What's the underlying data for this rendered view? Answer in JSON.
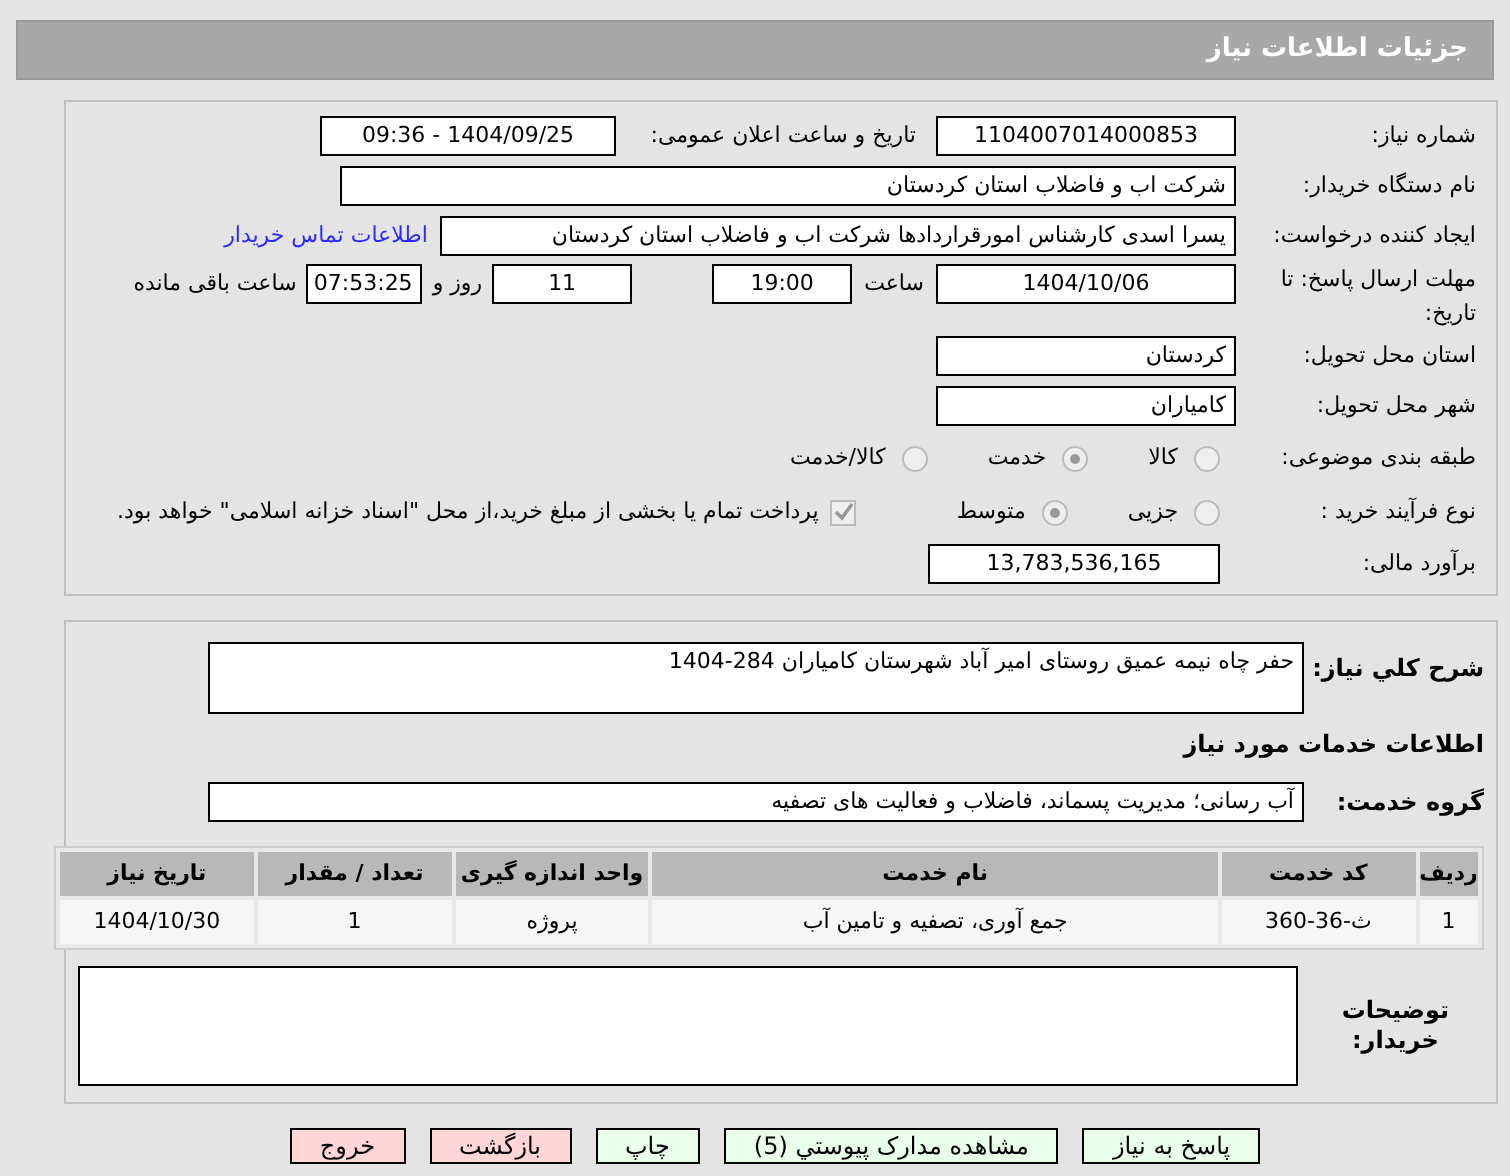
{
  "header": {
    "title": "جزئیات اطلاعات نیاز"
  },
  "need_number": {
    "label": "شماره نیاز:",
    "value": "1104007014000853"
  },
  "announce": {
    "label": "تاریخ و ساعت اعلان عمومی:",
    "value": "1404/09/25 - 09:36"
  },
  "buyer_org": {
    "label": "نام دستگاه خریدار:",
    "value": "شرکت اب و فاضلاب استان کردستان"
  },
  "requester": {
    "label": "ایجاد کننده درخواست:",
    "value": "یسرا اسدی کارشناس امورقراردادها شرکت اب و فاضلاب استان کردستان",
    "link": "اطلاعات تماس خریدار"
  },
  "deadline": {
    "label": "مهلت ارسال پاسخ: تا تاریخ:",
    "date": "1404/10/06",
    "time_label": "ساعت",
    "time": "19:00",
    "days": "11",
    "days_label": "روز و",
    "remaining": "07:53:25",
    "remaining_label": "ساعت باقی مانده"
  },
  "province": {
    "label": "استان محل تحویل:",
    "value": "کردستان"
  },
  "city": {
    "label": "شهر محل تحویل:",
    "value": "کامیاران"
  },
  "category": {
    "label": "طبقه بندی موضوعی:",
    "options": [
      {
        "label": "کالا",
        "selected": false
      },
      {
        "label": "خدمت",
        "selected": true
      },
      {
        "label": "کالا/خدمت",
        "selected": false
      }
    ]
  },
  "process": {
    "label": "نوع فرآیند خرید :",
    "options": [
      {
        "label": "جزیی",
        "selected": false
      },
      {
        "label": "متوسط",
        "selected": true
      }
    ],
    "payment": {
      "checked": true,
      "text": "پرداخت تمام یا بخشی از مبلغ خرید،از محل \"اسناد خزانه اسلامی\" خواهد بود."
    }
  },
  "estimate": {
    "label": "برآورد مالی:",
    "value": "13,783,536,165"
  },
  "summary": {
    "label": "شرح کلي نياز:",
    "value": "حفر چاه نیمه عمیق روستای امیر آباد شهرستان کامیاران 284-1404"
  },
  "services_heading": "اطلاعات خدمات مورد نیاز",
  "service_group": {
    "label": "گروه خدمت:",
    "value": "آب رسانی؛ مدیریت پسماند، فاضلاب و فعالیت های تصفیه"
  },
  "table": {
    "columns": [
      "ردیف",
      "کد خدمت",
      "نام خدمت",
      "واحد اندازه گیری",
      "تعداد / مقدار",
      "تاریخ نیاز"
    ],
    "rows": [
      [
        "1",
        "ث-36-360",
        "جمع آوری، تصفیه و تامین آب",
        "پروژه",
        "1",
        "1404/10/30"
      ]
    ]
  },
  "buyer_notes": {
    "label": "توضیحات خریدار:"
  },
  "buttons": [
    {
      "label": "پاسخ به نیاز",
      "kind": "green"
    },
    {
      "label": "مشاهده مدارک پیوستي (5)",
      "kind": "green"
    },
    {
      "label": "چاپ",
      "kind": "green"
    },
    {
      "label": "بازگشت",
      "kind": "red"
    },
    {
      "label": "خروج",
      "kind": "red"
    }
  ]
}
